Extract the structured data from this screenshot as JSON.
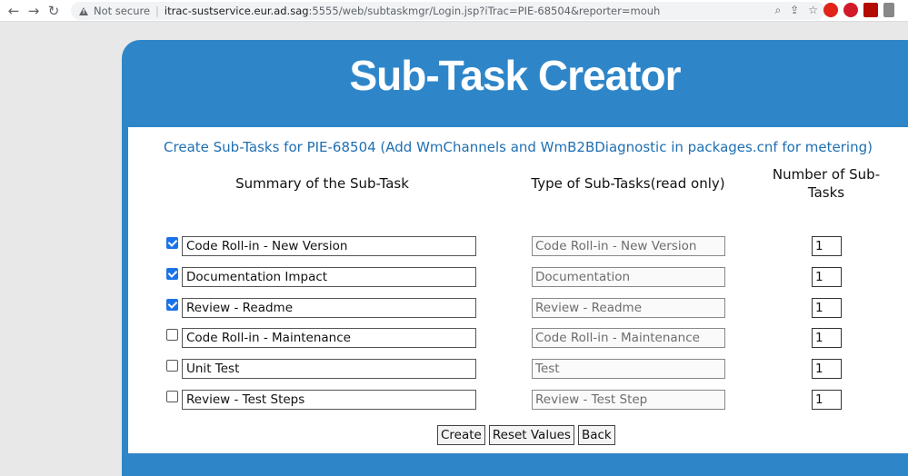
{
  "browser": {
    "security_label": "Not secure",
    "url_host": "itrac-sustservice.eur.ad.sag",
    "url_rest": ":5555/web/subtaskmgr/Login.jsp?iTrac=PIE-68504&reporter=mouh"
  },
  "page": {
    "title": "Sub-Task Creator",
    "subtitle": "Create Sub-Tasks for PIE-68504 (Add WmChannels and WmB2BDiagnostic in packages.cnf for metering)"
  },
  "columns": {
    "summary": "Summary of the Sub-Task",
    "type": "Type of Sub-Tasks(read only)",
    "number": "Number of Sub-Tasks"
  },
  "rows": [
    {
      "checked": true,
      "summary": "Code Roll-in - New Version",
      "type": "Code Roll-in - New Version",
      "count": "1"
    },
    {
      "checked": true,
      "summary": "Documentation Impact",
      "type": "Documentation",
      "count": "1"
    },
    {
      "checked": true,
      "summary": "Review - Readme",
      "type": "Review - Readme",
      "count": "1"
    },
    {
      "checked": false,
      "summary": "Code Roll-in - Maintenance",
      "type": "Code Roll-in - Maintenance",
      "count": "1"
    },
    {
      "checked": false,
      "summary": "Unit Test",
      "type": "Test",
      "count": "1"
    },
    {
      "checked": false,
      "summary": "Review - Test Steps",
      "type": "Review - Test Step",
      "count": "1"
    }
  ],
  "buttons": {
    "create": "Create",
    "reset": "Reset Values",
    "back": "Back"
  },
  "colors": {
    "header_blue": "#2e86c9",
    "subtitle_blue": "#1f6fb2",
    "checkbox_blue": "#1a73e8"
  }
}
